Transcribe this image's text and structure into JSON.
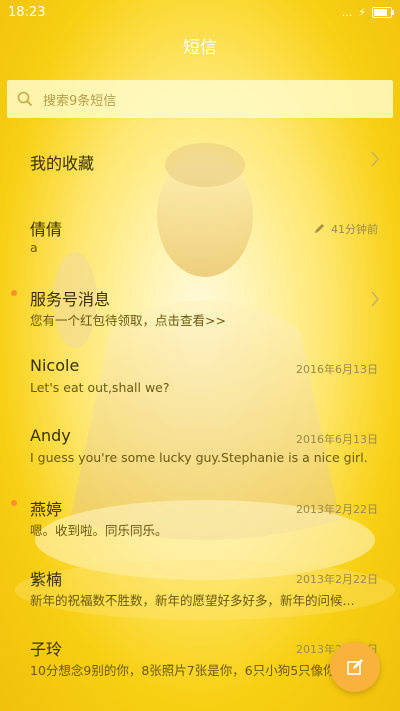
{
  "status": {
    "time": "18:23",
    "signal": "...",
    "battery_icon": "battery-icon"
  },
  "title": "短信",
  "search": {
    "placeholder": "搜索9条短信"
  },
  "items": [
    {
      "name": "我的收藏",
      "preview": "",
      "time": "",
      "unread": false,
      "chevron": true
    },
    {
      "name": "倩倩",
      "preview": "a",
      "time": "41分钟前",
      "unread": false,
      "draft": true
    },
    {
      "name": "服务号消息",
      "preview": "您有一个红包待领取，点击查看>>",
      "time": "",
      "unread": true,
      "chevron": true
    },
    {
      "name": "Nicole",
      "preview": "Let's eat out,shall we?",
      "time": "2016年6月13日",
      "unread": false
    },
    {
      "name": "Andy",
      "preview": "I guess you're some lucky guy.Stephanie is a nice girl.",
      "time": "2016年6月13日",
      "unread": false
    },
    {
      "name": "燕婷",
      "preview": "嗯。收到啦。同乐同乐。",
      "time": "2013年2月22日",
      "unread": true
    },
    {
      "name": "紫楠",
      "preview": "新年的祝福数不胜数，新年的愿望好多好多，新年的问候...",
      "time": "2013年2月22日",
      "unread": false
    },
    {
      "name": "子玲",
      "preview": "10分想念9别的你，8张照片7张是你，6只小狗5只像你",
      "time": "2013年2月22日",
      "unread": false
    }
  ],
  "colors": {
    "accent": "#f9b23b",
    "unread_dot": "#ff8f2a",
    "background": "#f7cf12"
  }
}
